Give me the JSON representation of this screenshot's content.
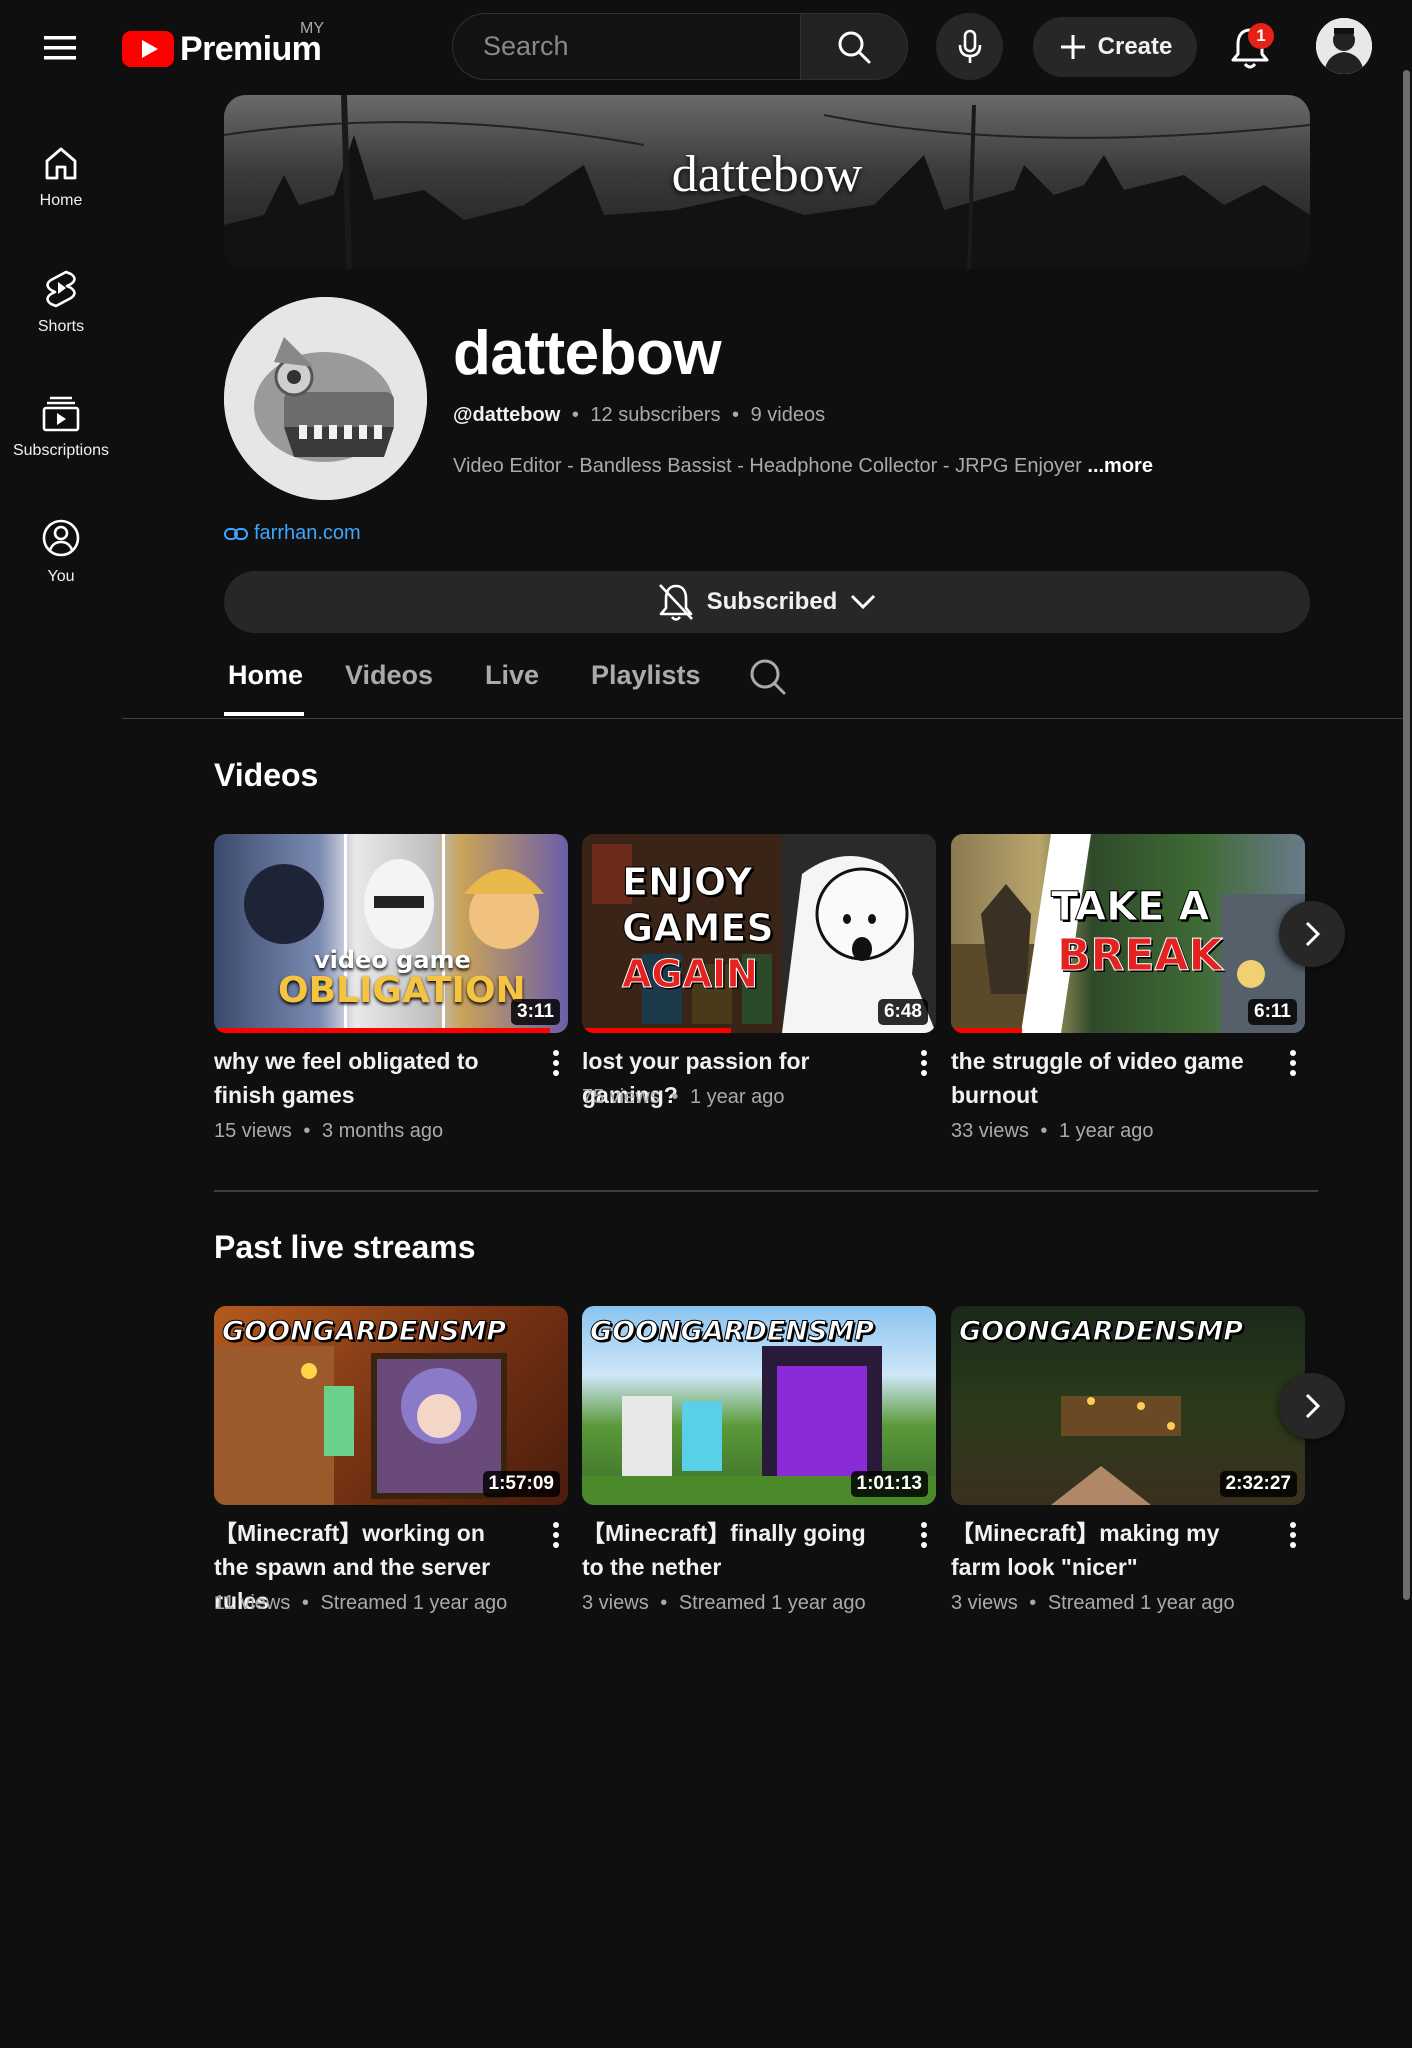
{
  "header": {
    "logo_text": "Premium",
    "region": "MY",
    "search_placeholder": "Search",
    "create_label": "Create",
    "notification_count": "1"
  },
  "sidebar": {
    "items": [
      {
        "label": "Home",
        "icon": "home-icon"
      },
      {
        "label": "Shorts",
        "icon": "shorts-icon"
      },
      {
        "label": "Subscriptions",
        "icon": "subscriptions-icon"
      },
      {
        "label": "You",
        "icon": "user-circle-icon"
      }
    ]
  },
  "banner": {
    "title": "dattebow"
  },
  "channel": {
    "name": "dattebow",
    "handle": "@dattebow",
    "subscribers": "12 subscribers",
    "video_count": "9 videos",
    "separator": "•",
    "description": "Video Editor - Bandless Bassist - Headphone Collector - JRPG Enjoyer",
    "more_label": "...more",
    "link": "farrhan.com",
    "subscribe_label": "Subscribed"
  },
  "tabs": [
    {
      "label": "Home",
      "active": true
    },
    {
      "label": "Videos",
      "active": false
    },
    {
      "label": "Live",
      "active": false
    },
    {
      "label": "Playlists",
      "active": false
    }
  ],
  "videos_section": {
    "title": "Videos",
    "items": [
      {
        "title": "why we feel obligated to finish games",
        "views": "15 views",
        "age": "3 months ago",
        "duration": "3:11",
        "thumb_text_1": "video game",
        "thumb_text_2": "OBLIGATION",
        "watched": 0.95
      },
      {
        "title": "lost your passion for gaming?",
        "views": "75 views",
        "age": "1 year ago",
        "duration": "6:48",
        "thumb_text_1": "ENJOY",
        "thumb_text_2": "GAMES",
        "thumb_text_3": "AGAIN",
        "watched": 0.42
      },
      {
        "title": "the struggle of video game burnout",
        "views": "33 views",
        "age": "1 year ago",
        "duration": "6:11",
        "thumb_text_1": "TAKE A",
        "thumb_text_2": "BREAK",
        "watched": 0.2
      }
    ]
  },
  "live_section": {
    "title": "Past live streams",
    "items": [
      {
        "title": "【Minecraft】working on the spawn and the server rules",
        "views": "11 views",
        "age": "Streamed 1 year ago",
        "duration": "1:57:09",
        "thumb_text": "GOONGARDENSMP"
      },
      {
        "title": "【Minecraft】finally going to the nether",
        "views": "3 views",
        "age": "Streamed 1 year ago",
        "duration": "1:01:13",
        "thumb_text": "GOONGARDENSMP"
      },
      {
        "title": "【Minecraft】making my farm look \"nicer\"",
        "views": "3 views",
        "age": "Streamed 1 year ago",
        "duration": "2:32:27",
        "thumb_text": "GOONGARDENSMP"
      }
    ]
  },
  "colors": {
    "background": "#0f0f0f",
    "brand_red": "#ff0000",
    "link_blue": "#3ea6ff",
    "chip": "#272727"
  }
}
